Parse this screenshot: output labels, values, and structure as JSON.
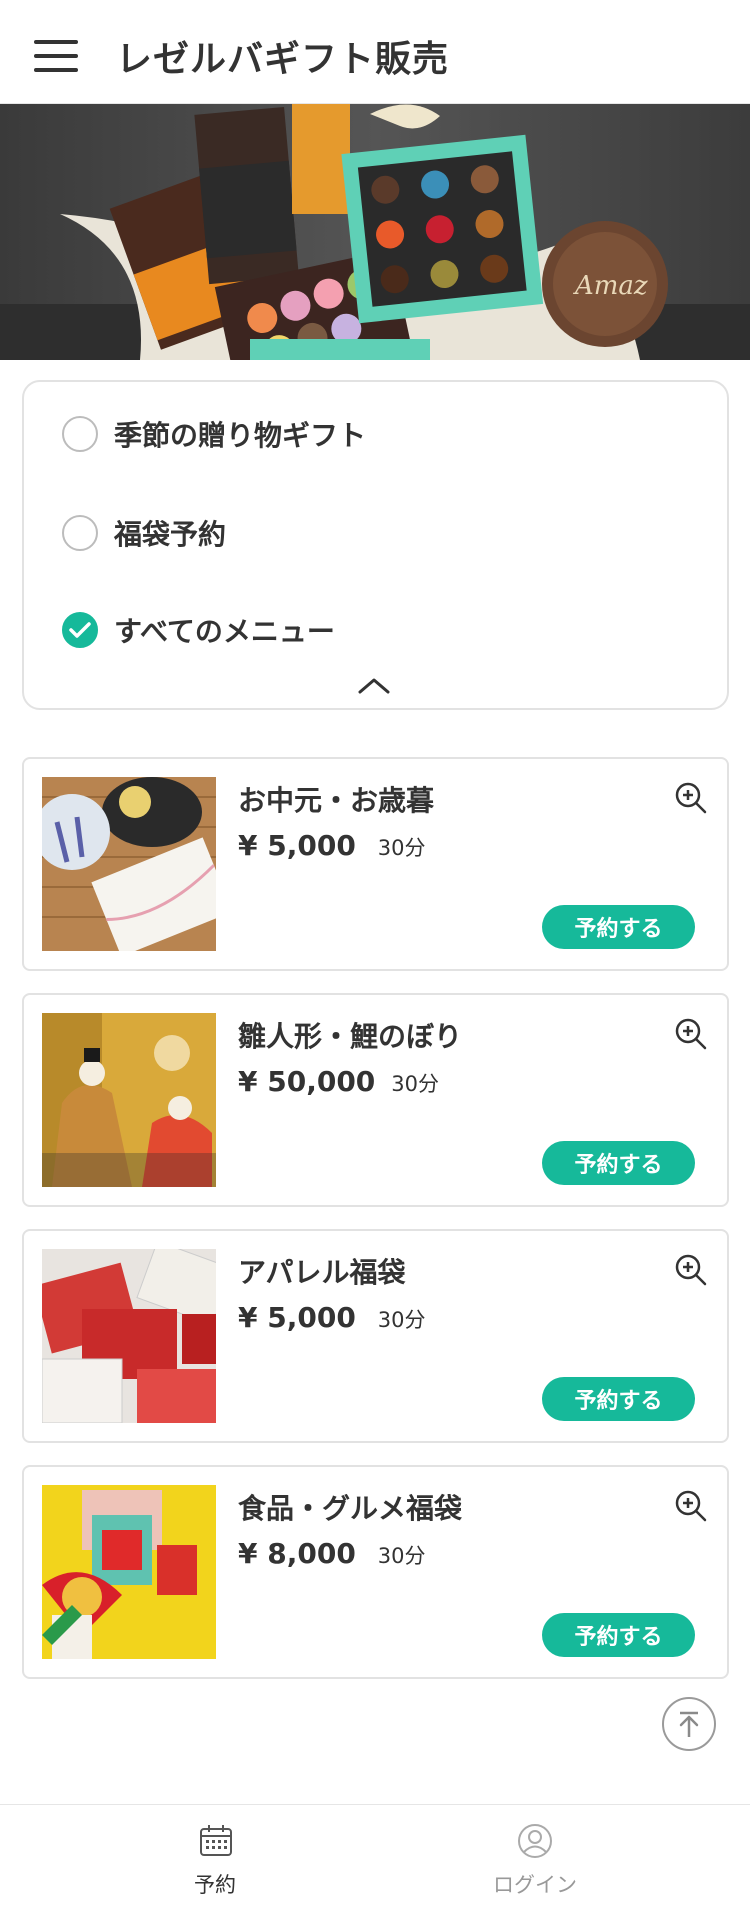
{
  "header": {
    "title": "レゼルバギフト販売",
    "menu_icon": "hamburger-menu-icon"
  },
  "filters": {
    "options": [
      {
        "label": "季節の贈り物ギフト",
        "checked": false
      },
      {
        "label": "福袋予約",
        "checked": false
      },
      {
        "label": "すべてのメニュー",
        "checked": true
      }
    ],
    "collapse_icon": "chevron-up-icon"
  },
  "products": [
    {
      "name": "お中元・お歳暮",
      "price": "¥ 5,000",
      "duration": "30分",
      "button": "予約する"
    },
    {
      "name": "雛人形・鯉のぼり",
      "price": "¥ 50,000",
      "duration": "30分",
      "button": "予約する"
    },
    {
      "name": "アパレル福袋",
      "price": "¥ 5,000",
      "duration": "30分",
      "button": "予約する"
    },
    {
      "name": "食品・グルメ福袋",
      "price": "¥ 8,000",
      "duration": "30分",
      "button": "予約する"
    }
  ],
  "footer": {
    "tabs": [
      {
        "label": "予約",
        "icon": "calendar-icon",
        "active": true
      },
      {
        "label": "ログイン",
        "icon": "user-icon",
        "active": false
      }
    ]
  },
  "colors": {
    "accent": "#16b99a",
    "text": "#333333",
    "inactive": "#999999"
  }
}
